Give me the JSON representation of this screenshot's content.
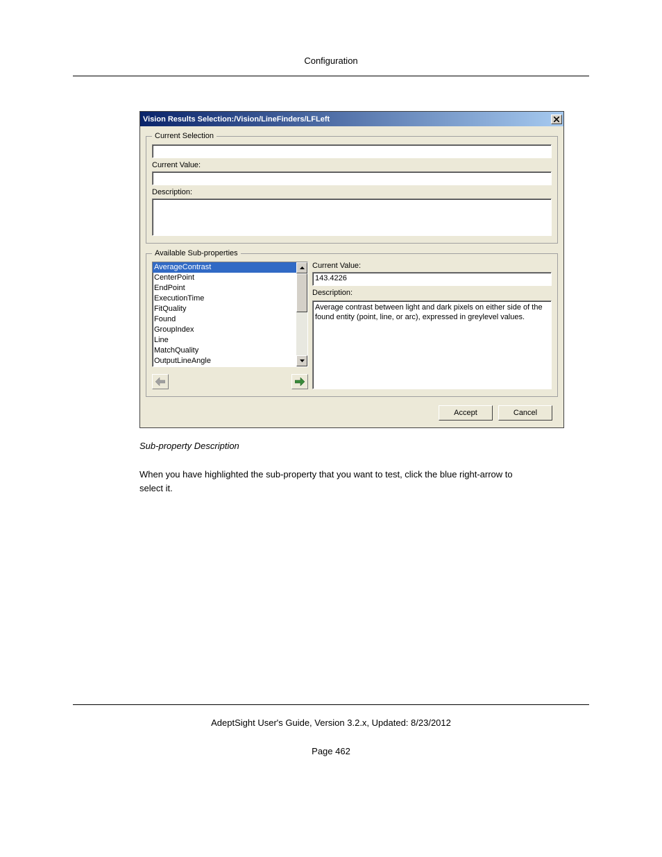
{
  "header": {
    "title": "Configuration"
  },
  "dialog": {
    "title": "Vision Results Selection:/Vision/LineFinders/LFLeft",
    "current_selection": {
      "legend": "Current Selection",
      "value_label": "Current Value:",
      "desc_label": "Description:"
    },
    "subprops": {
      "legend": "Available Sub-properties",
      "items": [
        "AverageContrast",
        "CenterPoint",
        "EndPoint",
        "ExecutionTime",
        "FitQuality",
        "Found",
        "GroupIndex",
        "Line",
        "MatchQuality",
        "OutputLineAngle"
      ],
      "cv_label": "Current Value:",
      "cv_value": "143.4226",
      "desc_label": "Description:",
      "desc_value": "Average contrast between light and dark pixels on either side of the found entity (point, line, or arc), expressed in greylevel values."
    },
    "buttons": {
      "accept": "Accept",
      "cancel": "Cancel"
    }
  },
  "caption": "Sub-property Description",
  "bodytext": "When you have highlighted the sub-property that you want to test, click the blue right-arrow to select it.",
  "footer": {
    "line": "AdeptSight User's Guide,  Version 3.2.x, Updated: 8/23/2012",
    "page": "Page 462"
  }
}
